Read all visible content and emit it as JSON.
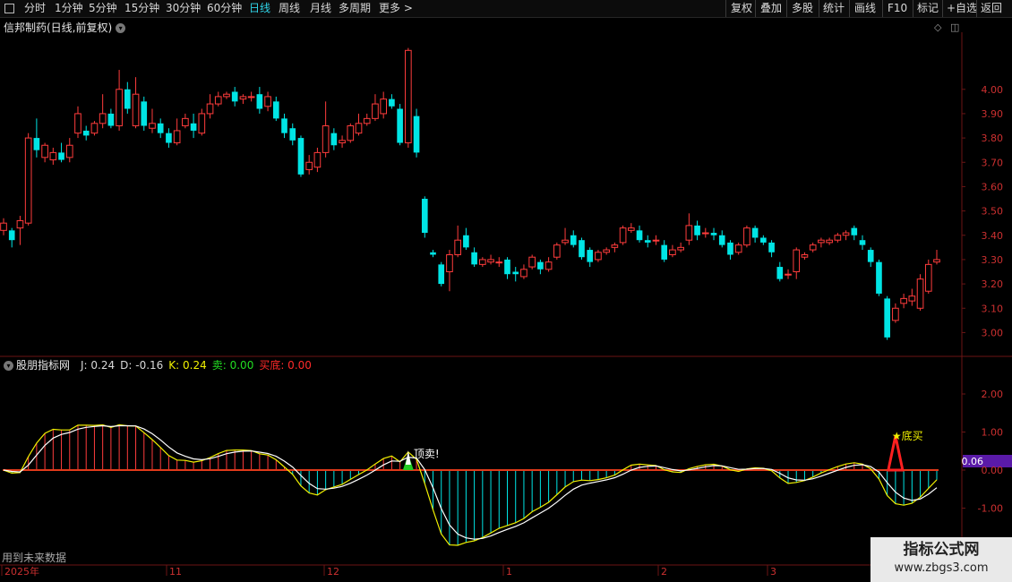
{
  "toolbar": {
    "periods": [
      "分时",
      "1分钟",
      "5分钟",
      "15分钟",
      "30分钟",
      "60分钟",
      "日线",
      "周线",
      "月线",
      "多周期",
      "更多 >"
    ],
    "active": "日线",
    "right": [
      "复权",
      "叠加",
      "多股",
      "统计",
      "画线",
      "F10",
      "标记",
      "+自选",
      "返回"
    ]
  },
  "main": {
    "title": "信邦制药(日线,前复权)",
    "price_ticks": [
      "4.00",
      "3.90",
      "3.80",
      "3.70",
      "3.60",
      "3.50",
      "3.40",
      "3.30",
      "3.20",
      "3.10",
      "3.00"
    ],
    "price_range": [
      2.95,
      4.22
    ]
  },
  "indicator": {
    "name": "股朋指标网",
    "fields": [
      {
        "label": "J: 0.24",
        "color": "#d8d8d8"
      },
      {
        "label": "D: -0.16",
        "color": "#d8d8d8"
      },
      {
        "label": "K: 0.24",
        "color": "#f0f000"
      },
      {
        "label": "卖: 0.00",
        "color": "#22dd22"
      },
      {
        "label": "买底: 0.00",
        "color": "#ff2a2a"
      }
    ],
    "ticks": [
      "2.00",
      "1.00",
      "0.00",
      "-1.00"
    ],
    "current_value": "0.06",
    "sell_label": "顶卖!",
    "buy_label": "★底买"
  },
  "date_axis": [
    "2025年",
    "11",
    "12",
    "1",
    "2",
    "3"
  ],
  "future_note": "用到未来数据",
  "watermark": {
    "line1": "指标公式网",
    "line2": "www.zbgs3.com"
  },
  "colors": {
    "up": "#ff3c3c",
    "down": "#00e5e5",
    "accent": "#2fd4e8",
    "grid": "#6b1515",
    "badge": "#5a1aa8"
  },
  "chart_data": {
    "type": "candlestick",
    "ylim": [
      2.95,
      4.22
    ],
    "candles": [
      [
        3.42,
        3.45,
        3.47,
        3.4
      ],
      [
        3.42,
        3.38,
        3.43,
        3.35
      ],
      [
        3.43,
        3.46,
        3.48,
        3.36
      ],
      [
        3.45,
        3.8,
        3.82,
        3.44
      ],
      [
        3.8,
        3.75,
        3.88,
        3.72
      ],
      [
        3.72,
        3.77,
        3.78,
        3.7
      ],
      [
        3.71,
        3.74,
        3.76,
        3.69
      ],
      [
        3.74,
        3.71,
        3.78,
        3.7
      ],
      [
        3.72,
        3.77,
        3.8,
        3.7
      ],
      [
        3.82,
        3.9,
        3.93,
        3.8
      ],
      [
        3.83,
        3.81,
        3.85,
        3.79
      ],
      [
        3.82,
        3.86,
        3.87,
        3.81
      ],
      [
        3.86,
        3.9,
        3.98,
        3.84
      ],
      [
        3.9,
        3.85,
        3.92,
        3.84
      ],
      [
        3.85,
        4.0,
        4.08,
        3.83
      ],
      [
        4.0,
        3.92,
        4.03,
        3.9
      ],
      [
        3.85,
        3.98,
        4.05,
        3.84
      ],
      [
        3.95,
        3.85,
        3.97,
        3.83
      ],
      [
        3.84,
        3.86,
        3.92,
        3.82
      ],
      [
        3.86,
        3.82,
        3.88,
        3.8
      ],
      [
        3.82,
        3.78,
        3.84,
        3.76
      ],
      [
        3.78,
        3.83,
        3.88,
        3.77
      ],
      [
        3.85,
        3.88,
        3.9,
        3.84
      ],
      [
        3.86,
        3.83,
        3.9,
        3.8
      ],
      [
        3.82,
        3.9,
        3.92,
        3.81
      ],
      [
        3.9,
        3.94,
        3.98,
        3.88
      ],
      [
        3.94,
        3.97,
        3.99,
        3.93
      ],
      [
        3.97,
        3.98,
        3.99,
        3.96
      ],
      [
        3.99,
        3.95,
        4.01,
        3.93
      ],
      [
        3.96,
        3.97,
        3.98,
        3.94
      ],
      [
        3.97,
        3.97,
        3.99,
        3.95
      ],
      [
        3.98,
        3.92,
        4.01,
        3.9
      ],
      [
        3.93,
        3.97,
        3.99,
        3.91
      ],
      [
        3.95,
        3.88,
        3.97,
        3.87
      ],
      [
        3.88,
        3.82,
        3.9,
        3.8
      ],
      [
        3.84,
        3.79,
        3.86,
        3.77
      ],
      [
        3.8,
        3.65,
        3.81,
        3.64
      ],
      [
        3.67,
        3.7,
        3.73,
        3.65
      ],
      [
        3.68,
        3.74,
        3.76,
        3.66
      ],
      [
        3.74,
        3.85,
        3.95,
        3.72
      ],
      [
        3.82,
        3.77,
        3.84,
        3.75
      ],
      [
        3.78,
        3.79,
        3.81,
        3.76
      ],
      [
        3.79,
        3.85,
        3.86,
        3.78
      ],
      [
        3.82,
        3.86,
        3.9,
        3.81
      ],
      [
        3.86,
        3.88,
        3.9,
        3.85
      ],
      [
        3.88,
        3.94,
        3.98,
        3.87
      ],
      [
        3.9,
        3.96,
        3.99,
        3.88
      ],
      [
        3.96,
        3.93,
        3.98,
        3.92
      ],
      [
        3.92,
        3.78,
        3.94,
        3.77
      ],
      [
        3.78,
        4.16,
        4.17,
        3.76
      ],
      [
        3.89,
        3.74,
        3.92,
        3.72
      ],
      [
        3.55,
        3.41,
        3.56,
        3.39
      ],
      [
        3.33,
        3.32,
        3.34,
        3.31
      ],
      [
        3.28,
        3.2,
        3.29,
        3.19
      ],
      [
        3.25,
        3.32,
        3.34,
        3.17
      ],
      [
        3.32,
        3.38,
        3.44,
        3.31
      ],
      [
        3.4,
        3.35,
        3.43,
        3.34
      ],
      [
        3.33,
        3.28,
        3.35,
        3.27
      ],
      [
        3.28,
        3.3,
        3.31,
        3.27
      ],
      [
        3.29,
        3.3,
        3.32,
        3.28
      ],
      [
        3.29,
        3.29,
        3.31,
        3.27
      ],
      [
        3.3,
        3.24,
        3.31,
        3.22
      ],
      [
        3.25,
        3.24,
        3.27,
        3.21
      ],
      [
        3.23,
        3.26,
        3.28,
        3.22
      ],
      [
        3.27,
        3.31,
        3.32,
        3.26
      ],
      [
        3.29,
        3.26,
        3.3,
        3.24
      ],
      [
        3.26,
        3.29,
        3.31,
        3.25
      ],
      [
        3.31,
        3.36,
        3.37,
        3.3
      ],
      [
        3.37,
        3.38,
        3.43,
        3.36
      ],
      [
        3.4,
        3.36,
        3.42,
        3.35
      ],
      [
        3.38,
        3.31,
        3.39,
        3.3
      ],
      [
        3.34,
        3.29,
        3.35,
        3.27
      ],
      [
        3.3,
        3.33,
        3.34,
        3.29
      ],
      [
        3.33,
        3.34,
        3.35,
        3.32
      ],
      [
        3.35,
        3.36,
        3.37,
        3.33
      ],
      [
        3.37,
        3.43,
        3.44,
        3.36
      ],
      [
        3.42,
        3.43,
        3.45,
        3.41
      ],
      [
        3.42,
        3.38,
        3.44,
        3.37
      ],
      [
        3.38,
        3.37,
        3.4,
        3.35
      ],
      [
        3.38,
        3.38,
        3.4,
        3.36
      ],
      [
        3.36,
        3.3,
        3.38,
        3.29
      ],
      [
        3.32,
        3.34,
        3.36,
        3.31
      ],
      [
        3.34,
        3.35,
        3.37,
        3.33
      ],
      [
        3.38,
        3.44,
        3.49,
        3.36
      ],
      [
        3.44,
        3.4,
        3.46,
        3.38
      ],
      [
        3.41,
        3.41,
        3.43,
        3.39
      ],
      [
        3.41,
        3.4,
        3.43,
        3.38
      ],
      [
        3.4,
        3.36,
        3.42,
        3.35
      ],
      [
        3.37,
        3.32,
        3.38,
        3.3
      ],
      [
        3.33,
        3.36,
        3.37,
        3.32
      ],
      [
        3.36,
        3.43,
        3.44,
        3.35
      ],
      [
        3.43,
        3.39,
        3.44,
        3.37
      ],
      [
        3.39,
        3.37,
        3.4,
        3.36
      ],
      [
        3.37,
        3.33,
        3.38,
        3.31
      ],
      [
        3.27,
        3.22,
        3.29,
        3.21
      ],
      [
        3.24,
        3.24,
        3.26,
        3.22
      ],
      [
        3.25,
        3.34,
        3.35,
        3.22
      ],
      [
        3.31,
        3.32,
        3.33,
        3.3
      ],
      [
        3.34,
        3.36,
        3.37,
        3.33
      ],
      [
        3.37,
        3.38,
        3.39,
        3.35
      ],
      [
        3.37,
        3.38,
        3.39,
        3.36
      ],
      [
        3.38,
        3.4,
        3.41,
        3.37
      ],
      [
        3.4,
        3.41,
        3.42,
        3.38
      ],
      [
        3.43,
        3.4,
        3.44,
        3.38
      ],
      [
        3.38,
        3.36,
        3.4,
        3.34
      ],
      [
        3.34,
        3.29,
        3.35,
        3.27
      ],
      [
        3.29,
        3.16,
        3.3,
        3.15
      ],
      [
        3.14,
        2.98,
        3.15,
        2.97
      ],
      [
        3.05,
        3.1,
        3.12,
        3.04
      ],
      [
        3.12,
        3.14,
        3.16,
        3.1
      ],
      [
        3.13,
        3.15,
        3.18,
        3.11
      ],
      [
        3.1,
        3.22,
        3.24,
        3.09
      ],
      [
        3.17,
        3.28,
        3.3,
        3.16
      ],
      [
        3.29,
        3.3,
        3.34,
        3.28
      ]
    ],
    "indicator_ylim": [
      -2.4,
      2.0
    ],
    "indicator_ticks": [
      2.0,
      1.0,
      0.0,
      -1.0
    ],
    "sell_signal_index": 49,
    "buy_signal_index": 108
  }
}
